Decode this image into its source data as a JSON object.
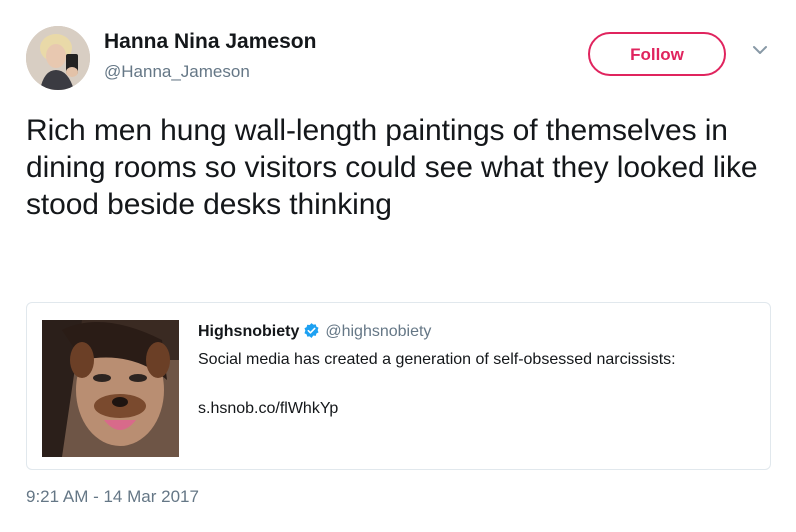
{
  "author": {
    "display_name": "Hanna Nina Jameson",
    "handle": "@Hanna_Jameson",
    "avatar_icon": "profile-photo"
  },
  "actions": {
    "follow_label": "Follow",
    "menu_icon": "chevron-down-icon"
  },
  "tweet": {
    "text": "Rich men hung wall-length paintings of themselves in dining rooms so visitors could see what they looked like stood beside desks thinking",
    "timestamp": "9:21 AM - 14 Mar 2017"
  },
  "quoted_tweet": {
    "display_name": "Highsnobiety",
    "handle": "@highsnobiety",
    "verified_icon": "verified-badge-icon",
    "text": "Social media has created a generation of self-obsessed narcissists:",
    "link": "s.hsnob.co/flWhkYp"
  },
  "colors": {
    "follow_accent": "#e0245e",
    "verified_blue": "#1da1f2",
    "secondary_text": "#657786",
    "primary_text": "#14171a",
    "card_border": "#e1e8ed"
  }
}
